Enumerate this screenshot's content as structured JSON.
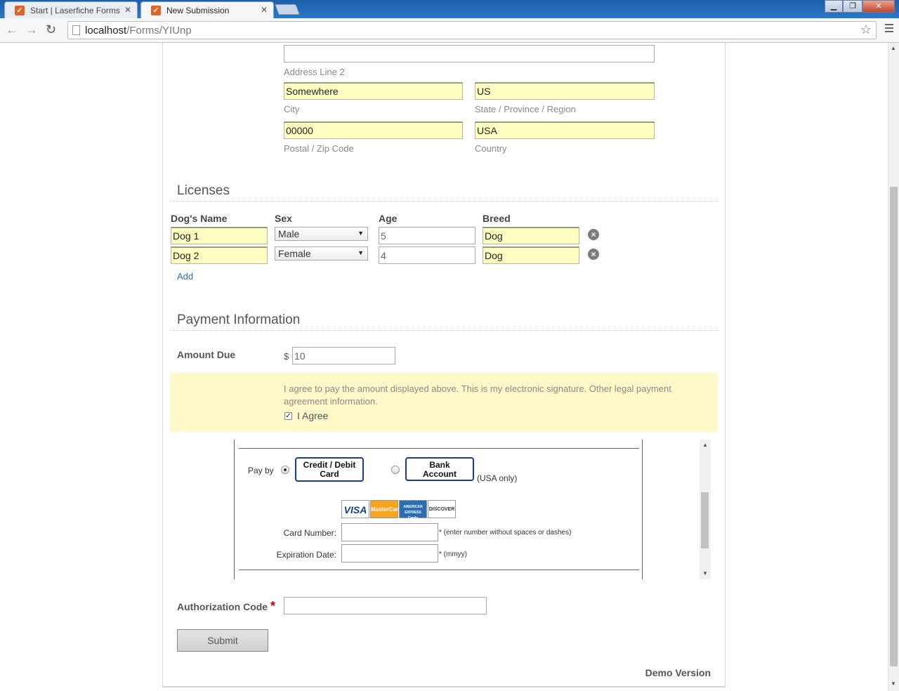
{
  "browser": {
    "tabs": [
      {
        "label": "Start | Laserfiche Forms",
        "active": false
      },
      {
        "label": "New Submission",
        "active": true
      }
    ],
    "url_host": "localhost",
    "url_path": "/Forms/YIUnp"
  },
  "address": {
    "line2_label": "Address Line 2",
    "line2_value": "",
    "city_value": "Somewhere",
    "city_label": "City",
    "state_value": "US",
    "state_label": "State / Province / Region",
    "zip_value": "00000",
    "zip_label": "Postal / Zip Code",
    "country_value": "USA",
    "country_label": "Country"
  },
  "licenses": {
    "title": "Licenses",
    "headers": {
      "name": "Dog's Name",
      "sex": "Sex",
      "age": "Age",
      "breed": "Breed"
    },
    "rows": [
      {
        "name": "Dog 1",
        "sex": "Male",
        "age": "5",
        "breed": "Dog"
      },
      {
        "name": "Dog 2",
        "sex": "Female",
        "age": "4",
        "breed": "Dog"
      }
    ],
    "add_label": "Add"
  },
  "payment": {
    "title": "Payment Information",
    "amount_label": "Amount Due",
    "currency": "$",
    "amount_value": "10",
    "agreement_text": "I agree to pay the amount displayed above. This is my electronic signature. Other legal payment agreement information.",
    "agree_label": "I Agree",
    "agree_checked": true,
    "pay_by_label": "Pay by",
    "credit_btn": "Credit / Debit Card",
    "bank_btn": "Bank Account",
    "usa_only": "(USA only)",
    "card_logos": [
      "VISA",
      "MasterCard",
      "AMERICAN EXPRESS Cards",
      "DISCOVER"
    ],
    "card_number_label": "Card Number:",
    "card_number_note": "* (enter number without spaces or dashes)",
    "expiration_label": "Expiration Date:",
    "expiration_note": "* (mmyy)",
    "auth_label": "Authorization Code",
    "required_mark": "*",
    "submit_label": "Submit"
  },
  "footer": {
    "demo": "Demo Version"
  },
  "colors": {
    "required": "#cc0000",
    "link": "#2a6ab5",
    "agree_bg": "#fff8c8",
    "filled_input": "#ffffc2"
  }
}
